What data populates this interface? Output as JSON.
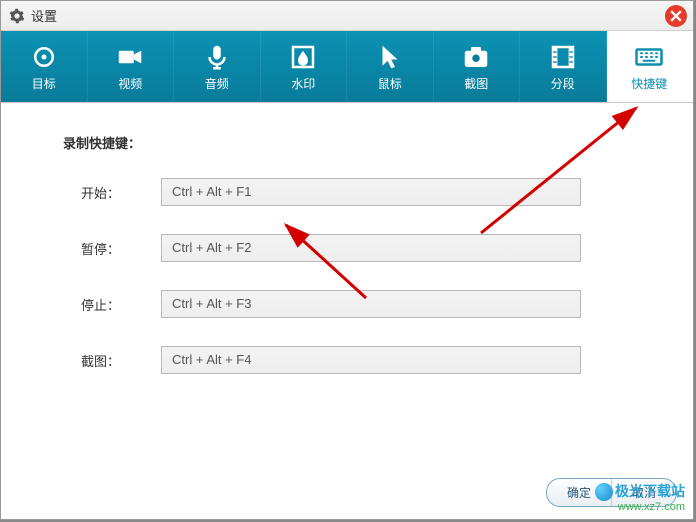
{
  "window": {
    "title": "设置"
  },
  "tabs": [
    {
      "label": "目标"
    },
    {
      "label": "视频"
    },
    {
      "label": "音频"
    },
    {
      "label": "水印"
    },
    {
      "label": "鼠标"
    },
    {
      "label": "截图"
    },
    {
      "label": "分段"
    },
    {
      "label": "快捷键"
    }
  ],
  "section": {
    "title": "录制快捷键：",
    "fields": [
      {
        "label": "开始：",
        "value": "Ctrl + Alt + F1"
      },
      {
        "label": "暂停：",
        "value": "Ctrl + Alt + F2"
      },
      {
        "label": "停止：",
        "value": "Ctrl + Alt + F3"
      },
      {
        "label": "截图：",
        "value": "Ctrl + Alt + F4"
      }
    ]
  },
  "footer": {
    "ok": "确定",
    "cancel": "取消"
  },
  "watermark": {
    "line1": "极光下载站",
    "line2": "www.xz7.com"
  }
}
